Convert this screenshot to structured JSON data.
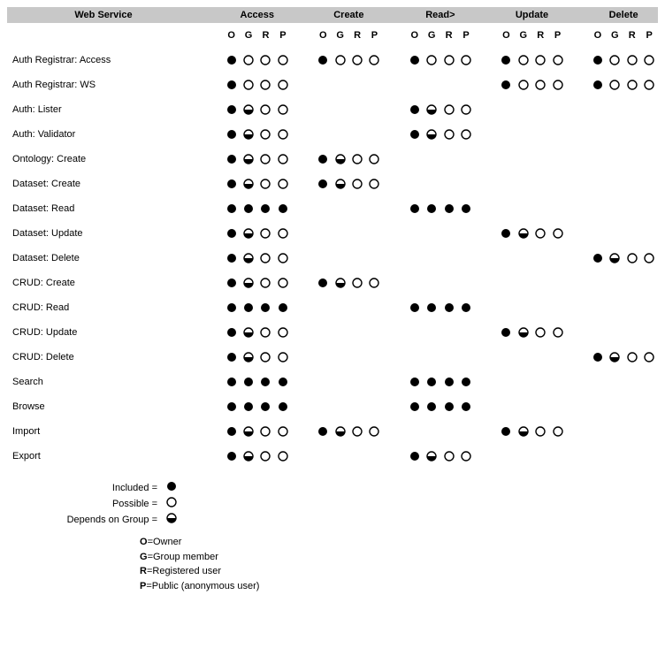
{
  "headers": {
    "ws": "Web Service",
    "groups": [
      "Access",
      "Create",
      "Read>",
      "Update",
      "Delete"
    ],
    "sub": [
      "O",
      "G",
      "R",
      "P"
    ]
  },
  "rows": [
    {
      "name": "Auth Registrar: Access",
      "Access": [
        "F",
        "E",
        "E",
        "E"
      ],
      "Create": [
        "F",
        "E",
        "E",
        "E"
      ],
      "Read": [
        "F",
        "E",
        "E",
        "E"
      ],
      "Update": [
        "F",
        "E",
        "E",
        "E"
      ],
      "Delete": [
        "F",
        "E",
        "E",
        "E"
      ]
    },
    {
      "name": "Auth Registrar: WS",
      "Access": [
        "F",
        "E",
        "E",
        "E"
      ],
      "Create": null,
      "Read": null,
      "Update": [
        "F",
        "E",
        "E",
        "E"
      ],
      "Delete": [
        "F",
        "E",
        "E",
        "E"
      ]
    },
    {
      "name": "Auth: Lister",
      "Access": [
        "F",
        "H",
        "E",
        "E"
      ],
      "Create": null,
      "Read": [
        "F",
        "H",
        "E",
        "E"
      ],
      "Update": null,
      "Delete": null
    },
    {
      "name": "Auth: Validator",
      "Access": [
        "F",
        "H",
        "E",
        "E"
      ],
      "Create": null,
      "Read": [
        "F",
        "H",
        "E",
        "E"
      ],
      "Update": null,
      "Delete": null
    },
    {
      "name": "Ontology: Create",
      "Access": [
        "F",
        "H",
        "E",
        "E"
      ],
      "Create": [
        "F",
        "H",
        "E",
        "E"
      ],
      "Read": null,
      "Update": null,
      "Delete": null
    },
    {
      "name": "Dataset: Create",
      "Access": [
        "F",
        "H",
        "E",
        "E"
      ],
      "Create": [
        "F",
        "H",
        "E",
        "E"
      ],
      "Read": null,
      "Update": null,
      "Delete": null
    },
    {
      "name": "Dataset: Read",
      "Access": [
        "F",
        "F",
        "F",
        "F"
      ],
      "Create": null,
      "Read": [
        "F",
        "F",
        "F",
        "F"
      ],
      "Update": null,
      "Delete": null
    },
    {
      "name": "Dataset: Update",
      "Access": [
        "F",
        "H",
        "E",
        "E"
      ],
      "Create": null,
      "Read": null,
      "Update": [
        "F",
        "H",
        "E",
        "E"
      ],
      "Delete": null
    },
    {
      "name": "Dataset: Delete",
      "Access": [
        "F",
        "H",
        "E",
        "E"
      ],
      "Create": null,
      "Read": null,
      "Update": null,
      "Delete": [
        "F",
        "H",
        "E",
        "E"
      ]
    },
    {
      "name": "CRUD: Create",
      "Access": [
        "F",
        "H",
        "E",
        "E"
      ],
      "Create": [
        "F",
        "H",
        "E",
        "E"
      ],
      "Read": null,
      "Update": null,
      "Delete": null
    },
    {
      "name": "CRUD: Read",
      "Access": [
        "F",
        "F",
        "F",
        "F"
      ],
      "Create": null,
      "Read": [
        "F",
        "F",
        "F",
        "F"
      ],
      "Update": null,
      "Delete": null
    },
    {
      "name": "CRUD: Update",
      "Access": [
        "F",
        "H",
        "E",
        "E"
      ],
      "Create": null,
      "Read": null,
      "Update": [
        "F",
        "H",
        "E",
        "E"
      ],
      "Delete": null
    },
    {
      "name": "CRUD: Delete",
      "Access": [
        "F",
        "H",
        "E",
        "E"
      ],
      "Create": null,
      "Read": null,
      "Update": null,
      "Delete": [
        "F",
        "H",
        "E",
        "E"
      ]
    },
    {
      "name": "Search",
      "Access": [
        "F",
        "F",
        "F",
        "F"
      ],
      "Create": null,
      "Read": [
        "F",
        "F",
        "F",
        "F"
      ],
      "Update": null,
      "Delete": null
    },
    {
      "name": "Browse",
      "Access": [
        "F",
        "F",
        "F",
        "F"
      ],
      "Create": null,
      "Read": [
        "F",
        "F",
        "F",
        "F"
      ],
      "Update": null,
      "Delete": null
    },
    {
      "name": "Import",
      "Access": [
        "F",
        "H",
        "E",
        "E"
      ],
      "Create": [
        "F",
        "H",
        "E",
        "E"
      ],
      "Read": null,
      "Update": [
        "F",
        "H",
        "E",
        "E"
      ],
      "Delete": null
    },
    {
      "name": "Export",
      "Access": [
        "F",
        "H",
        "E",
        "E"
      ],
      "Create": null,
      "Read": [
        "F",
        "H",
        "E",
        "E"
      ],
      "Update": null,
      "Delete": null
    }
  ],
  "legend": {
    "included": "Included =",
    "possible": "Possible =",
    "depends": "Depends on Group ="
  },
  "keys": [
    {
      "k": "O",
      "v": "=Owner"
    },
    {
      "k": "G",
      "v": "=Group member"
    },
    {
      "k": "R",
      "v": "=Registered user"
    },
    {
      "k": "P",
      "v": "=Public (anonymous user)"
    }
  ],
  "chart_data": {
    "type": "table",
    "title": "Web Service permission matrix",
    "value_encoding": {
      "F": "Included (filled)",
      "E": "Possible (empty)",
      "H": "Depends on Group (half)"
    },
    "columns_major": [
      "Access",
      "Create",
      "Read",
      "Update",
      "Delete"
    ],
    "columns_minor": [
      "O",
      "G",
      "R",
      "P"
    ],
    "rows": [
      "Auth Registrar: Access",
      "Auth Registrar: WS",
      "Auth: Lister",
      "Auth: Validator",
      "Ontology: Create",
      "Dataset: Create",
      "Dataset: Read",
      "Dataset: Update",
      "Dataset: Delete",
      "CRUD: Create",
      "CRUD: Read",
      "CRUD: Update",
      "CRUD: Delete",
      "Search",
      "Browse",
      "Import",
      "Export"
    ]
  }
}
